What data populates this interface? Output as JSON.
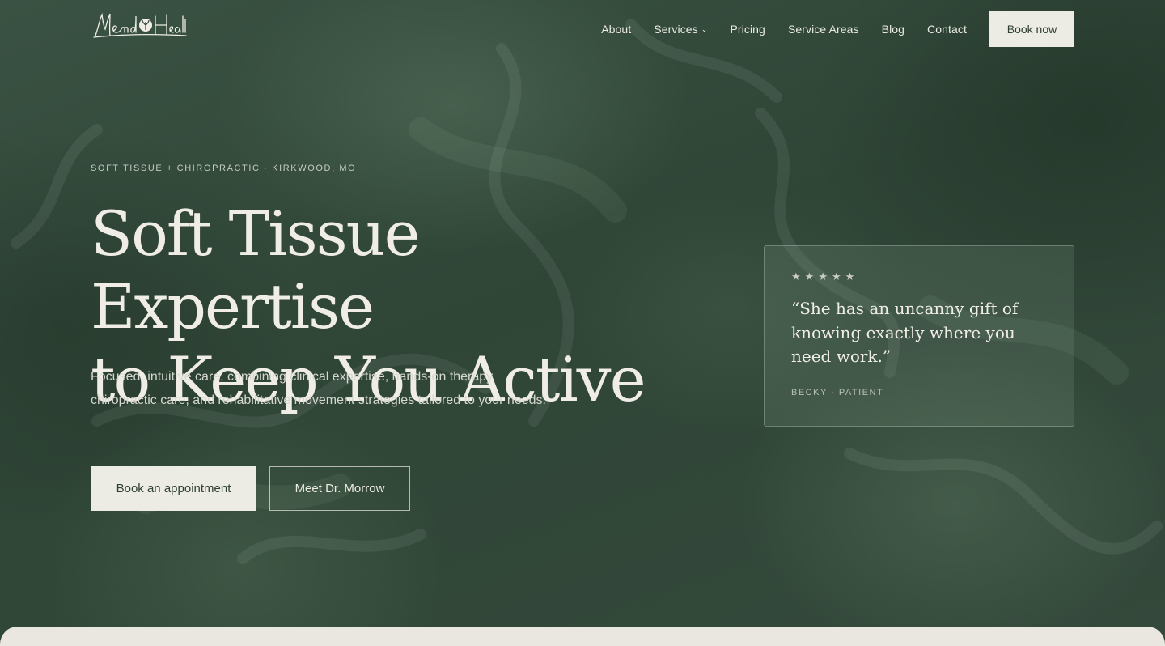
{
  "nav": {
    "logo_text": "Mend Health",
    "items": [
      {
        "label": "About"
      },
      {
        "label": "Services",
        "has_dropdown": true
      },
      {
        "label": "Pricing"
      },
      {
        "label": "Service Areas"
      },
      {
        "label": "Blog"
      },
      {
        "label": "Contact"
      }
    ],
    "cta_label": "Book now"
  },
  "hero": {
    "eyebrow": "SOFT TISSUE + CHIROPRACTIC · KIRKWOOD, MO",
    "headline_line1": "Soft Tissue Expertise",
    "headline_line2": "to Keep You Active",
    "description": "Focused, intuitive care, combining clinical expertise, hands-on therapy, chiropractic care, and rehabilitative movement strategies tailored to your needs.",
    "primary_button": "Book an appointment",
    "secondary_button": "Meet Dr. Morrow"
  },
  "testimonial": {
    "rating": 5,
    "quote": "“She has an uncanny gift of knowing exactly where you need work.”",
    "attribution": "BECKY · PATIENT"
  },
  "colors": {
    "background": "#33483a",
    "text_light": "#efede5",
    "button_fill": "#ecebe4",
    "panel": "#e9e7e0"
  },
  "icons": [
    "logo-leaf-icon",
    "chevron-down-icon",
    "star-icon"
  ]
}
